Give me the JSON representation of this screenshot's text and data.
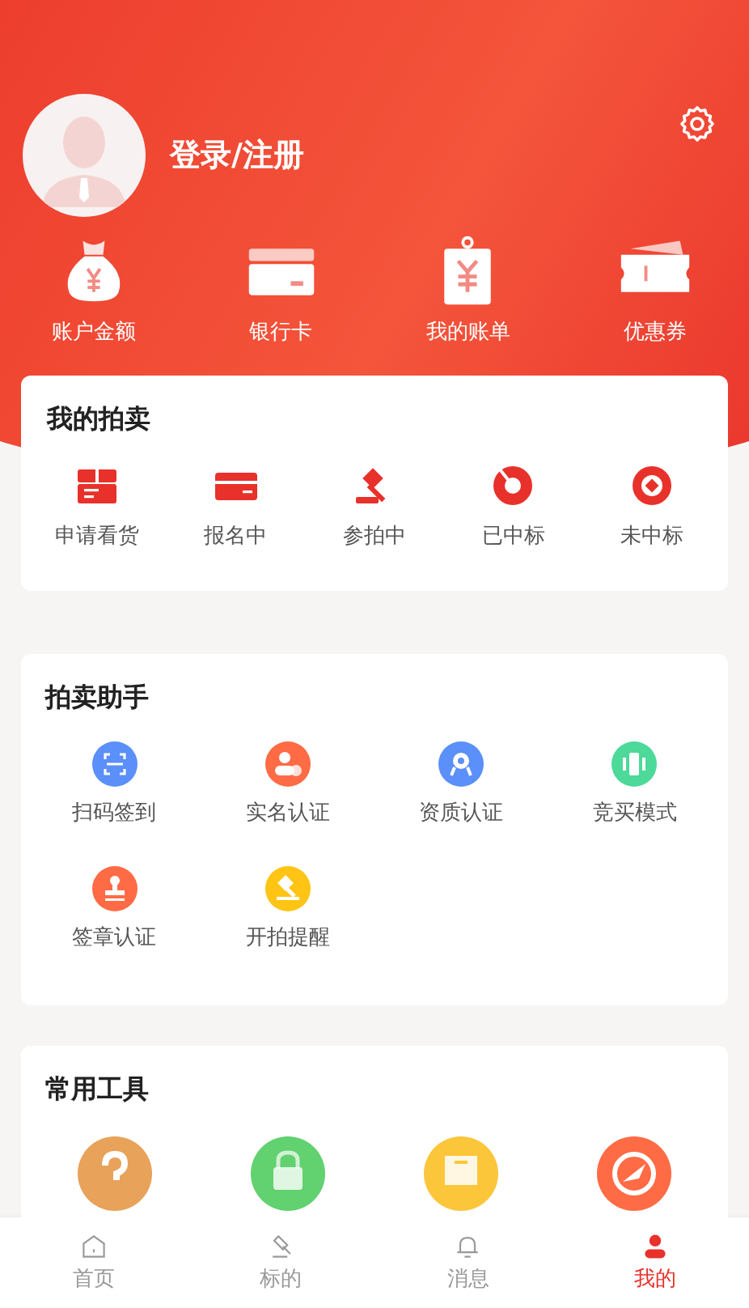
{
  "profile": {
    "login_label": "登录/注册"
  },
  "wallet": [
    {
      "label": "账户金额"
    },
    {
      "label": "银行卡"
    },
    {
      "label": "我的账单"
    },
    {
      "label": "优惠券"
    }
  ],
  "my_auctions": {
    "title": "我的拍卖",
    "items": [
      {
        "label": "申请看货"
      },
      {
        "label": "报名中"
      },
      {
        "label": "参拍中"
      },
      {
        "label": "已中标"
      },
      {
        "label": "未中标"
      }
    ]
  },
  "assistant": {
    "title": "拍卖助手",
    "items": [
      {
        "label": "扫码签到",
        "color": "#5b8ff9"
      },
      {
        "label": "实名认证",
        "color": "#ff6b45"
      },
      {
        "label": "资质认证",
        "color": "#5b8ff9"
      },
      {
        "label": "竞买模式",
        "color": "#4cd99a"
      },
      {
        "label": "签章认证",
        "color": "#ff6b45"
      },
      {
        "label": "开拍提醒",
        "color": "#ffc414"
      }
    ]
  },
  "tools": {
    "title": "常用工具",
    "items": [
      {
        "color": "#e8a25a"
      },
      {
        "color": "#62d16f"
      },
      {
        "color": "#fcc63a"
      },
      {
        "color": "#ff6b45"
      }
    ]
  },
  "tabbar": [
    {
      "label": "首页",
      "selected": false
    },
    {
      "label": "标的",
      "selected": false
    },
    {
      "label": "消息",
      "selected": false
    },
    {
      "label": "我的",
      "selected": true
    }
  ]
}
